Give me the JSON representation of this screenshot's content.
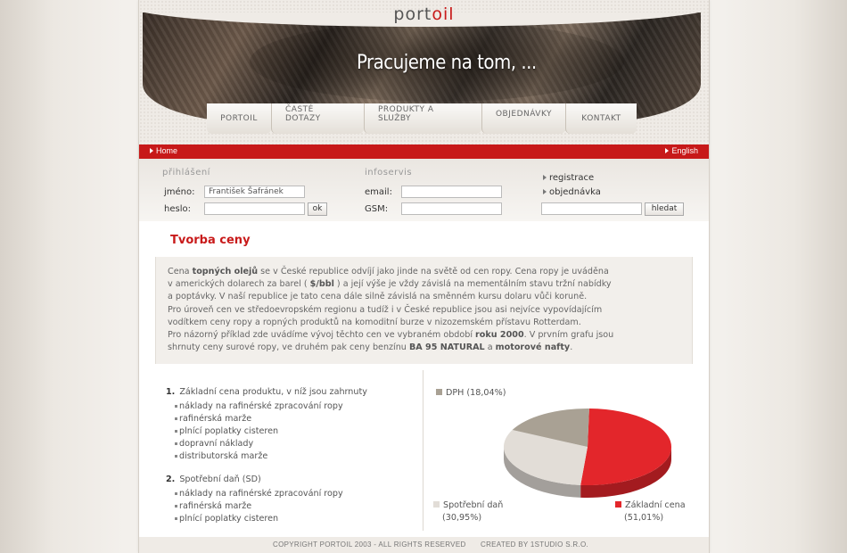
{
  "logo": {
    "part1": "port",
    "part2": "oil"
  },
  "banner": {
    "slogan": "Pracujeme na tom, ..."
  },
  "nav": [
    {
      "label": "PORTOIL"
    },
    {
      "label": "ČASTÉ DOTAZY"
    },
    {
      "label": "PRODUKTY A SLUŽBY"
    },
    {
      "label": "OBJEDNÁVKY"
    },
    {
      "label": "KONTAKT"
    }
  ],
  "redbar": {
    "home": "Home",
    "english": "English"
  },
  "login": {
    "title": "přihlášení",
    "name_label": "jméno:",
    "name_value": "František Šafránek",
    "password_label": "heslo:",
    "ok_label": "ok"
  },
  "infoservis": {
    "title": "infoservis",
    "email_label": "email:",
    "gsm_label": "GSM:"
  },
  "links": {
    "registrace": "registrace",
    "objednavka": "objednávka",
    "search_button": "hledat"
  },
  "content": {
    "heading": "Tvorba ceny",
    "intro": [
      [
        "Cena ",
        {
          "b": "topných olejů"
        },
        " se v České republice odvíjí jako jinde na světě od cen ropy. Cena ropy je uváděna"
      ],
      [
        "v amerických dolarech za barel ( ",
        {
          "b": "$/bbl"
        },
        " ) a její výše je vždy závislá na mementálním stavu tržní nabídky"
      ],
      [
        "a poptávky. V naší republice je tato cena dále silně závislá na směnném kursu dolaru vůči koruně."
      ],
      [
        "Pro úroveň cen ve středoevropském regionu a tudíž i v České republice jsou asi nejvíce vypovídajícím"
      ],
      [
        "vodítkem ceny ropy a ropných produktů na komoditní burze v nizozemském přístavu Rotterdam."
      ],
      [
        "Pro názorný příklad zde uvádíme vývoj těchto cen ve vybraném období ",
        {
          "b": "roku 2000"
        },
        ". V prvním grafu jsou"
      ],
      [
        "shrnuty ceny surové ropy, ve druhém pak ceny benzínu ",
        {
          "b": "BA 95 NATURAL"
        },
        " a ",
        {
          "b": "motorové nafty"
        },
        "."
      ]
    ],
    "groups": [
      {
        "num": "1.",
        "title": "Základní cena produktu, v níž jsou zahrnuty",
        "items": [
          "náklady na rafinérské zpracování ropy",
          "rafinérská marže",
          "plnící poplatky cisteren",
          "dopravní náklady",
          "distributorská marže"
        ]
      },
      {
        "num": "2.",
        "title": "Spotřební daň (SD)",
        "items": [
          "náklady na rafinérské zpracování ropy",
          "rafinérská marže",
          "plnící poplatky cisteren"
        ]
      }
    ]
  },
  "chart_data": {
    "type": "pie",
    "title": "",
    "series": [
      {
        "name": "Základní cena",
        "value_label": "(51,01%)",
        "value": 51.01,
        "color": "#e3262b"
      },
      {
        "name": "Spotřební daň",
        "value_label": "(30,95%)",
        "value": 30.95,
        "color": "#e2ddd7"
      },
      {
        "name": "DPH",
        "value_label": "(18,04%)",
        "value": 18.04,
        "color": "#a9a194"
      }
    ],
    "legend_labels": {
      "dph": "DPH (18,04%)",
      "sd_name": "Spotřební daň",
      "sd_value": "(30,95%)",
      "zc_name": "Základní cena",
      "zc_value": "(51,01%)"
    }
  },
  "footer": {
    "copyright": "COPYRIGHT Portoil 2003 - ALL RIGHTS RESERVED",
    "created": "CREATED BY 1studio s.r.o."
  }
}
